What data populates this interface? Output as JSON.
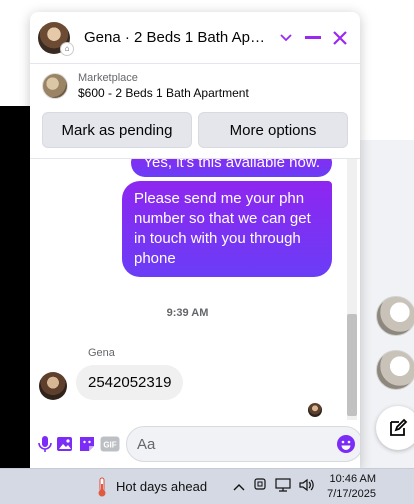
{
  "chat": {
    "title": "Gena · 2 Beds 1 Bath Apart…",
    "listing_label": "Marketplace",
    "listing_name": "$600 - 2 Beds 1 Bath Apartment",
    "mark_pending_label": "Mark as pending",
    "more_options_label": "More options",
    "messages": {
      "out_1": "Yes, it's this available now.",
      "out_2": "Please send me your phn number so that we can get in touch with you through phone",
      "timestamp": "9:39 AM",
      "sender_name": "Gena",
      "in_1": "2542052319"
    },
    "composer": {
      "placeholder": "Aa",
      "value": ""
    },
    "accent_color": "#7b2cf7",
    "header_icon_color": "#9b27f5"
  },
  "taskbar": {
    "weather_text": "Hot days ahead",
    "time": "10:46 AM",
    "date": "7/17/2025"
  }
}
